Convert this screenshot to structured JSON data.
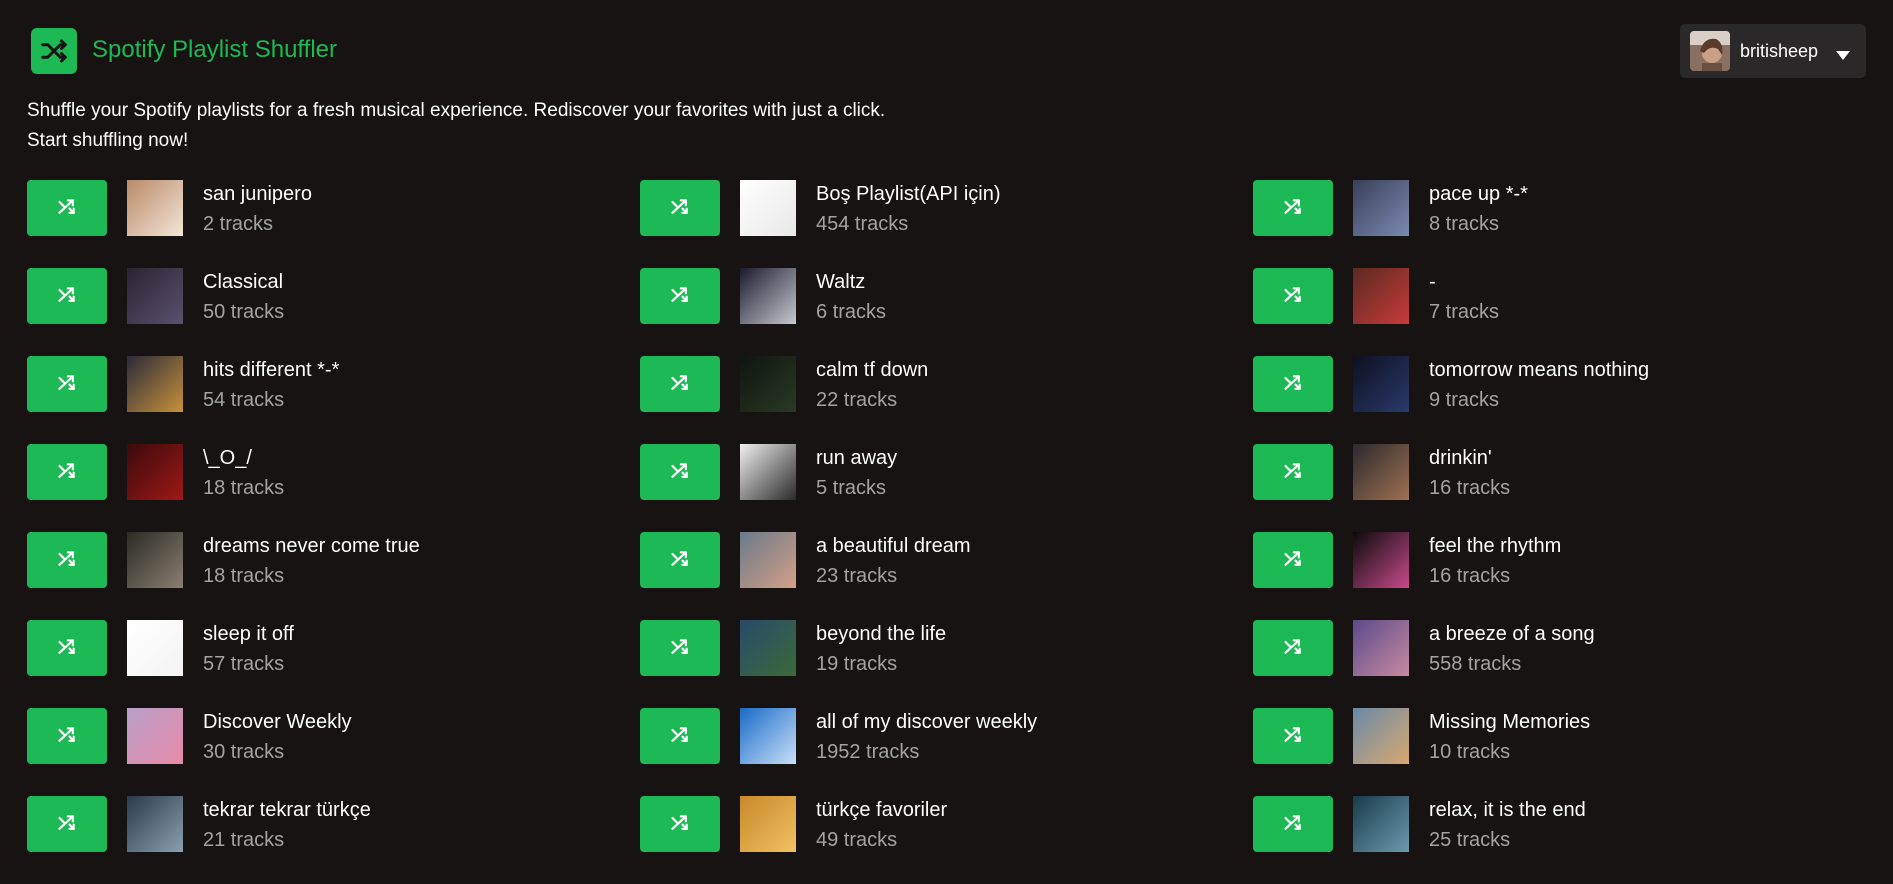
{
  "app": {
    "title": "Spotify Playlist Shuffler",
    "logo_icon": "shuffle-icon",
    "accent_color": "#1db954"
  },
  "user": {
    "name": "britisheep",
    "menu_icon": "caret-down-icon"
  },
  "intro": {
    "line1": "Shuffle your Spotify playlists for a fresh musical experience. Rediscover your favorites with just a click.",
    "line2": "Start shuffling now!"
  },
  "playlists": [
    {
      "name": "san junipero",
      "tracks": "2 tracks",
      "cover": [
        "#b98a6a",
        "#f4e6d6"
      ]
    },
    {
      "name": "Boş Playlist(API için)",
      "tracks": "454 tracks",
      "cover": [
        "#ffffff",
        "#e8e8e8"
      ]
    },
    {
      "name": "pace up *-*",
      "tracks": "8 tracks",
      "cover": [
        "#3a3f5a",
        "#7a8ab0"
      ]
    },
    {
      "name": "Classical",
      "tracks": "50 tracks",
      "cover": [
        "#2b2330",
        "#5a5070"
      ]
    },
    {
      "name": "Waltz",
      "tracks": "6 tracks",
      "cover": [
        "#1a1a2e",
        "#c8c8d0"
      ]
    },
    {
      "name": "-",
      "tracks": "7 tracks",
      "cover": [
        "#5a2a20",
        "#c83a3a"
      ]
    },
    {
      "name": "hits different *-*",
      "tracks": "54 tracks",
      "cover": [
        "#2a2a3a",
        "#c8913a"
      ]
    },
    {
      "name": "calm tf down",
      "tracks": "22 tracks",
      "cover": [
        "#0e1410",
        "#2a3a24"
      ]
    },
    {
      "name": "tomorrow means nothing",
      "tracks": "9 tracks",
      "cover": [
        "#0c1020",
        "#2a3a6a"
      ]
    },
    {
      "name": "\\_O_/",
      "tracks": "18 tracks",
      "cover": [
        "#3a0a0a",
        "#a01818"
      ]
    },
    {
      "name": "run away",
      "tracks": "5 tracks",
      "cover": [
        "#f0f0f0",
        "#2a2a2a"
      ]
    },
    {
      "name": "drinkin'",
      "tracks": "16 tracks",
      "cover": [
        "#2a2a30",
        "#a07050"
      ]
    },
    {
      "name": "dreams never come true",
      "tracks": "18 tracks",
      "cover": [
        "#2a2a24",
        "#8a8070"
      ]
    },
    {
      "name": "a beautiful dream",
      "tracks": "23 tracks",
      "cover": [
        "#6a7a8a",
        "#d4a088"
      ]
    },
    {
      "name": "feel the rhythm",
      "tracks": "16 tracks",
      "cover": [
        "#0a0a0a",
        "#c84a8a"
      ]
    },
    {
      "name": "sleep it off",
      "tracks": "57 tracks",
      "cover": [
        "#ffffff",
        "#f4f4f4"
      ]
    },
    {
      "name": "beyond the life",
      "tracks": "19 tracks",
      "cover": [
        "#2a4a6a",
        "#3a6a3a"
      ]
    },
    {
      "name": "a breeze of a song",
      "tracks": "558 tracks",
      "cover": [
        "#5a4a8a",
        "#c88aa0"
      ]
    },
    {
      "name": "Discover Weekly",
      "tracks": "30 tracks",
      "cover": [
        "#b8a0c8",
        "#e88aa8"
      ]
    },
    {
      "name": "all of my discover weekly",
      "tracks": "1952 tracks",
      "cover": [
        "#1a6ac8",
        "#c8e0f8"
      ]
    },
    {
      "name": "Missing Memories",
      "tracks": "10 tracks",
      "cover": [
        "#6a8aa8",
        "#d8a870"
      ]
    },
    {
      "name": "tekrar tekrar türkçe",
      "tracks": "21 tracks",
      "cover": [
        "#2a3a4a",
        "#8aa0b0"
      ]
    },
    {
      "name": "türkçe favoriler",
      "tracks": "49 tracks",
      "cover": [
        "#c88a2a",
        "#f0c060"
      ]
    },
    {
      "name": "relax, it is the end",
      "tracks": "25 tracks",
      "cover": [
        "#1a3a4a",
        "#6a9ab0"
      ]
    }
  ]
}
